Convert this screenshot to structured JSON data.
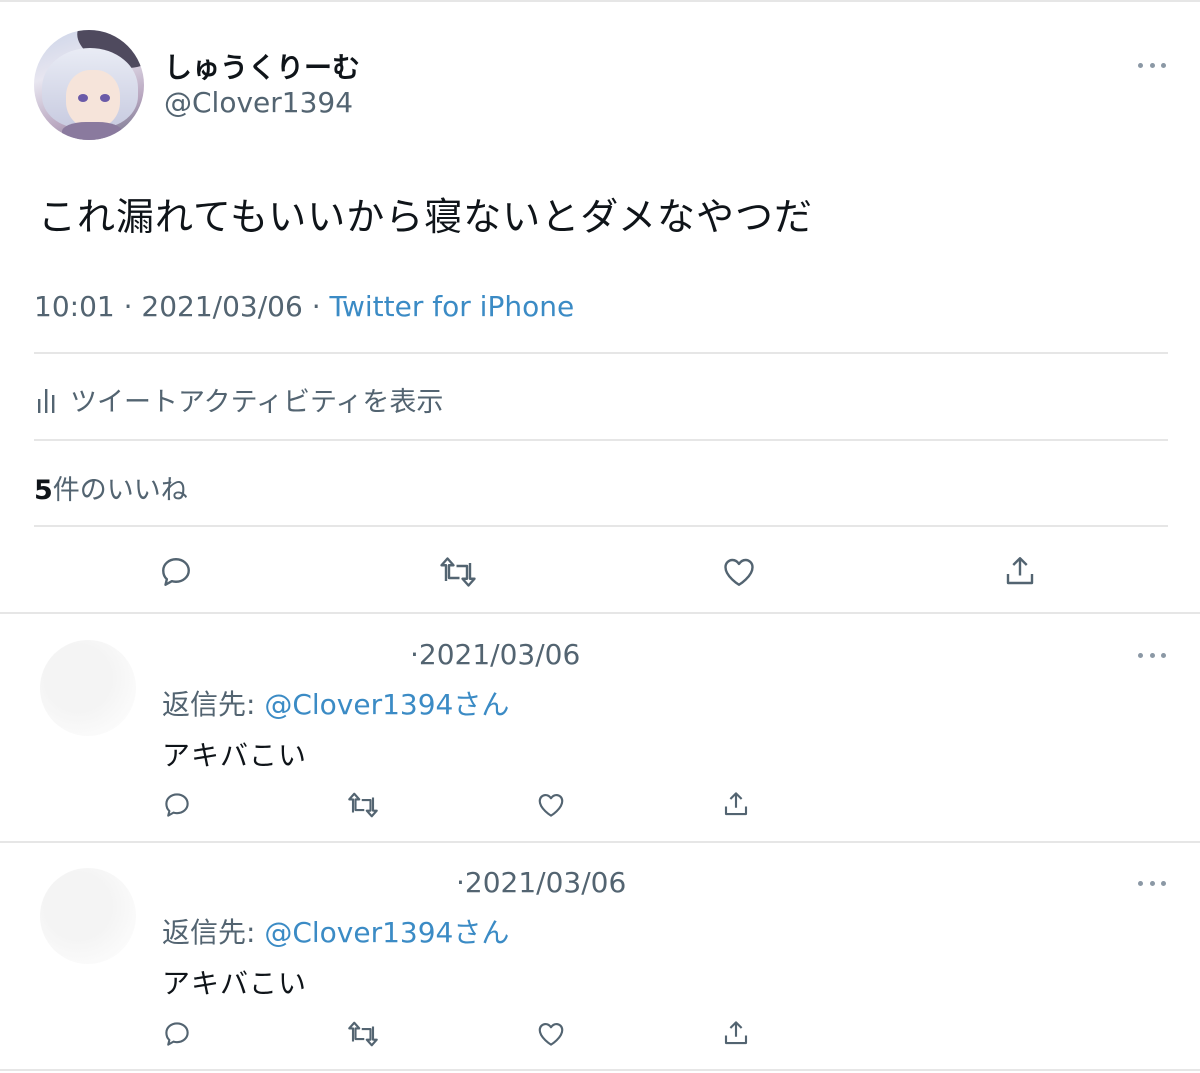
{
  "tweet": {
    "display_name": "しゅうくりーむ",
    "handle": "@Clover1394",
    "text": "これ漏れてもいいから寝ないとダメなやつだ",
    "time": "10:01",
    "date": "2021/03/06",
    "source": "Twitter for iPhone",
    "activity_label": "ツイートアクティビティを表示",
    "likes_count": "5",
    "likes_label": "件のいいね"
  },
  "icons": {
    "more": "more-dots-icon",
    "reply": "reply-bubble-icon",
    "retweet": "retweet-icon",
    "like": "heart-icon",
    "share": "share-icon",
    "activity": "bar-chart-icon"
  },
  "colors": {
    "text": "#0f1419",
    "secondary": "#536471",
    "link": "#3b8bc5",
    "divider": "#e6e6e6"
  },
  "replies": [
    {
      "date": "2021/03/06",
      "reply_to_label": "返信先:",
      "reply_to_handle": "@Clover1394さん",
      "text": "アキバこい"
    },
    {
      "date": "2021/03/06",
      "reply_to_label": "返信先:",
      "reply_to_handle": "@Clover1394さん",
      "text": "アキバこい"
    }
  ]
}
